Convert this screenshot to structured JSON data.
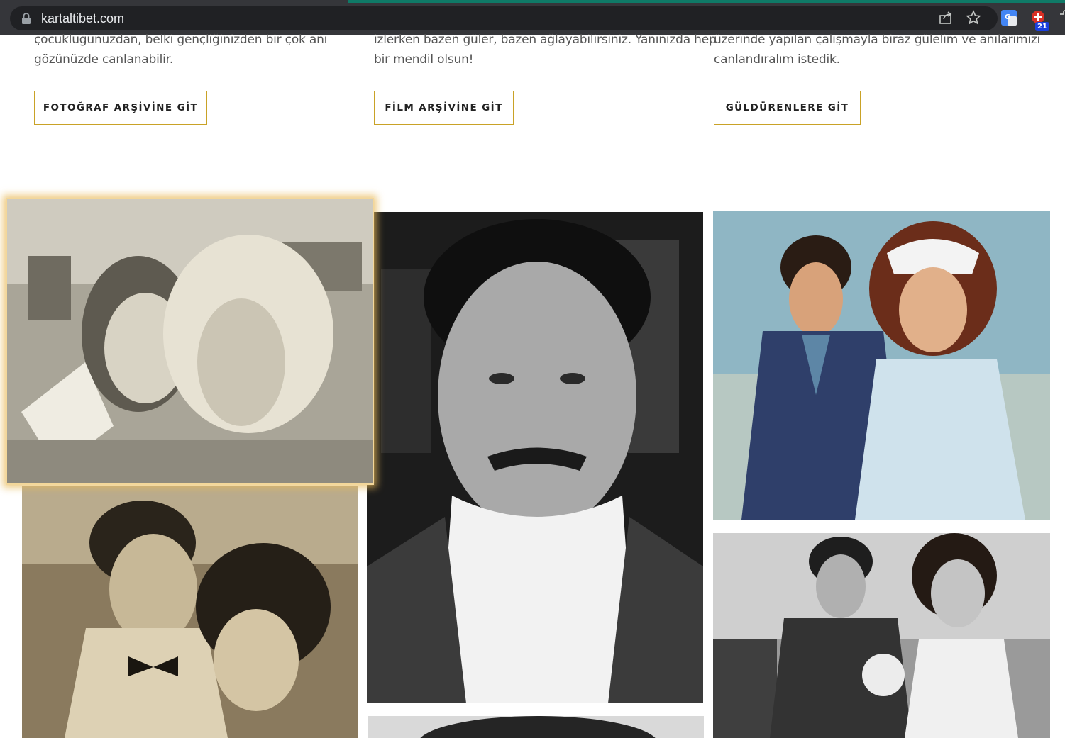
{
  "browser": {
    "url": "kartaltibet.com",
    "extension_badge": "21",
    "icons": [
      "lock-icon",
      "share-icon",
      "star-icon",
      "translate-icon",
      "extension-icon"
    ]
  },
  "columns": [
    {
      "text_lines": [
        "çocukluğunuzdan, belki gençliğinizden bir çok anı",
        "gözünüzde canlanabilir."
      ],
      "button": "FOTOĞRAF ARŞİVİNE GİT"
    },
    {
      "text_lines": [
        "izlerken bazen güler, bazen ağlayabilirsiniz. Yanınızda hep",
        "bir mendil olsun!"
      ],
      "button": "FİLM ARŞİVİNE GİT"
    },
    {
      "text_lines": [
        "üzerinde yapılan çalışmayla biraz gülelim ve anılarımızı",
        "canlandıralım istedik."
      ],
      "button": "GÜLDÜRENLERE GİT"
    }
  ],
  "colors": {
    "accent_border": "#c9a227",
    "chrome_bg": "#35363a",
    "omnibox_bg": "#202124"
  }
}
